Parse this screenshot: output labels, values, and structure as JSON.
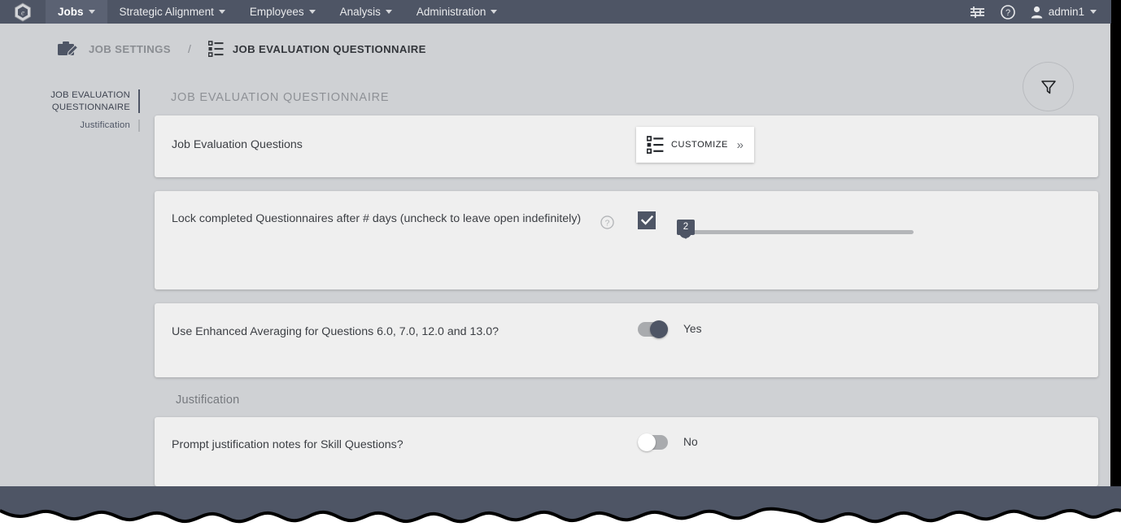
{
  "topnav": {
    "logo_icon": "hexagon-logo-icon",
    "items": [
      {
        "label": "Jobs",
        "active": true,
        "has_caret": true
      },
      {
        "label": "Strategic Alignment",
        "active": false,
        "has_caret": true
      },
      {
        "label": "Employees",
        "active": false,
        "has_caret": true
      },
      {
        "label": "Analysis",
        "active": false,
        "has_caret": true
      },
      {
        "label": "Administration",
        "active": false,
        "has_caret": true
      }
    ],
    "settings_icon": "sliders-icon",
    "help_icon": "help-circle-icon",
    "user_icon": "user-avatar-icon",
    "user_label": "admin1"
  },
  "breadcrumb": {
    "parent_icon": "briefcase-edit-icon",
    "parent_label": "JOB SETTINGS",
    "separator": "/",
    "current_icon": "checklist-icon",
    "current_label": "JOB EVALUATION QUESTIONNAIRE",
    "filter_icon": "filter-funnel-icon"
  },
  "subnav": {
    "items": [
      {
        "label": "JOB EVALUATION QUESTIONNAIRE",
        "active": true
      },
      {
        "label": "Justification",
        "active": false
      }
    ]
  },
  "content": {
    "section_title": "JOB EVALUATION QUESTIONNAIRE",
    "row_questions": {
      "label": "Job Evaluation Questions",
      "customize_icon": "checklist-icon",
      "customize_label": "CUSTOMIZE",
      "chevron_icon": "double-chevron-right-icon"
    },
    "row_lock": {
      "label": "Lock completed Questionnaires after # days (uncheck to leave open indefinitely)",
      "help_icon": "help-circle-icon",
      "checkbox_checked": true,
      "slider_value": "2",
      "slider_min": 1,
      "slider_max": 60,
      "slider_percent": 2
    },
    "row_averaging": {
      "label": "Use Enhanced Averaging for Questions 6.0, 7.0, 12.0 and 13.0?",
      "toggle_state": "on",
      "toggle_value": "Yes"
    },
    "justification_title": "Justification",
    "row_prompt": {
      "label": "Prompt justification notes for Skill Questions?",
      "toggle_state": "off",
      "toggle_value": "No"
    }
  },
  "colors": {
    "navbar": "#4e5565",
    "canvas": "#cfd1d4",
    "card": "#efefef",
    "accent": "#4e5565",
    "track": "#a9abae"
  }
}
